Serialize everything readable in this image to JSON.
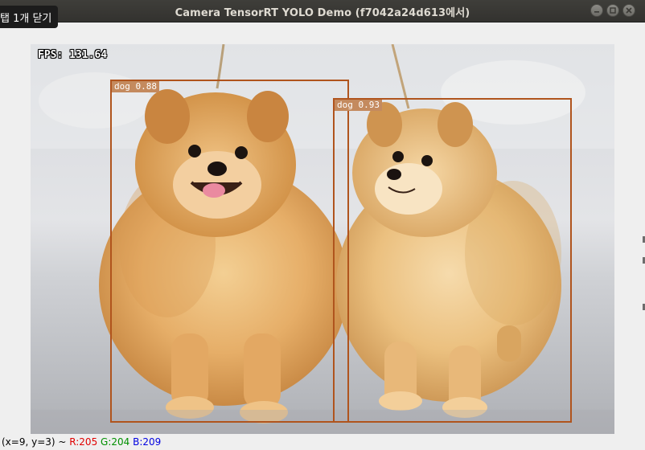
{
  "window": {
    "title": "Camera TensorRT YOLO Demo (f7042a24d613에서)",
    "controls": [
      "minimize",
      "maximize",
      "close"
    ]
  },
  "tooltip": {
    "text": "탭 1개 닫기"
  },
  "overlay": {
    "fps_text": "FPS: 131.64"
  },
  "detections": [
    {
      "label": "dog 0.88",
      "color": "#b0541d"
    },
    {
      "label": "dog 0.93",
      "color": "#b0541d"
    }
  ],
  "status_bar": {
    "coords": "(x=9, y=3) ~",
    "r": "R:205",
    "g": "G:204",
    "b": "B:209"
  },
  "colors": {
    "bbox": "#b0541d",
    "titlebar": "#3c3b37",
    "window_bg": "#efefef"
  }
}
